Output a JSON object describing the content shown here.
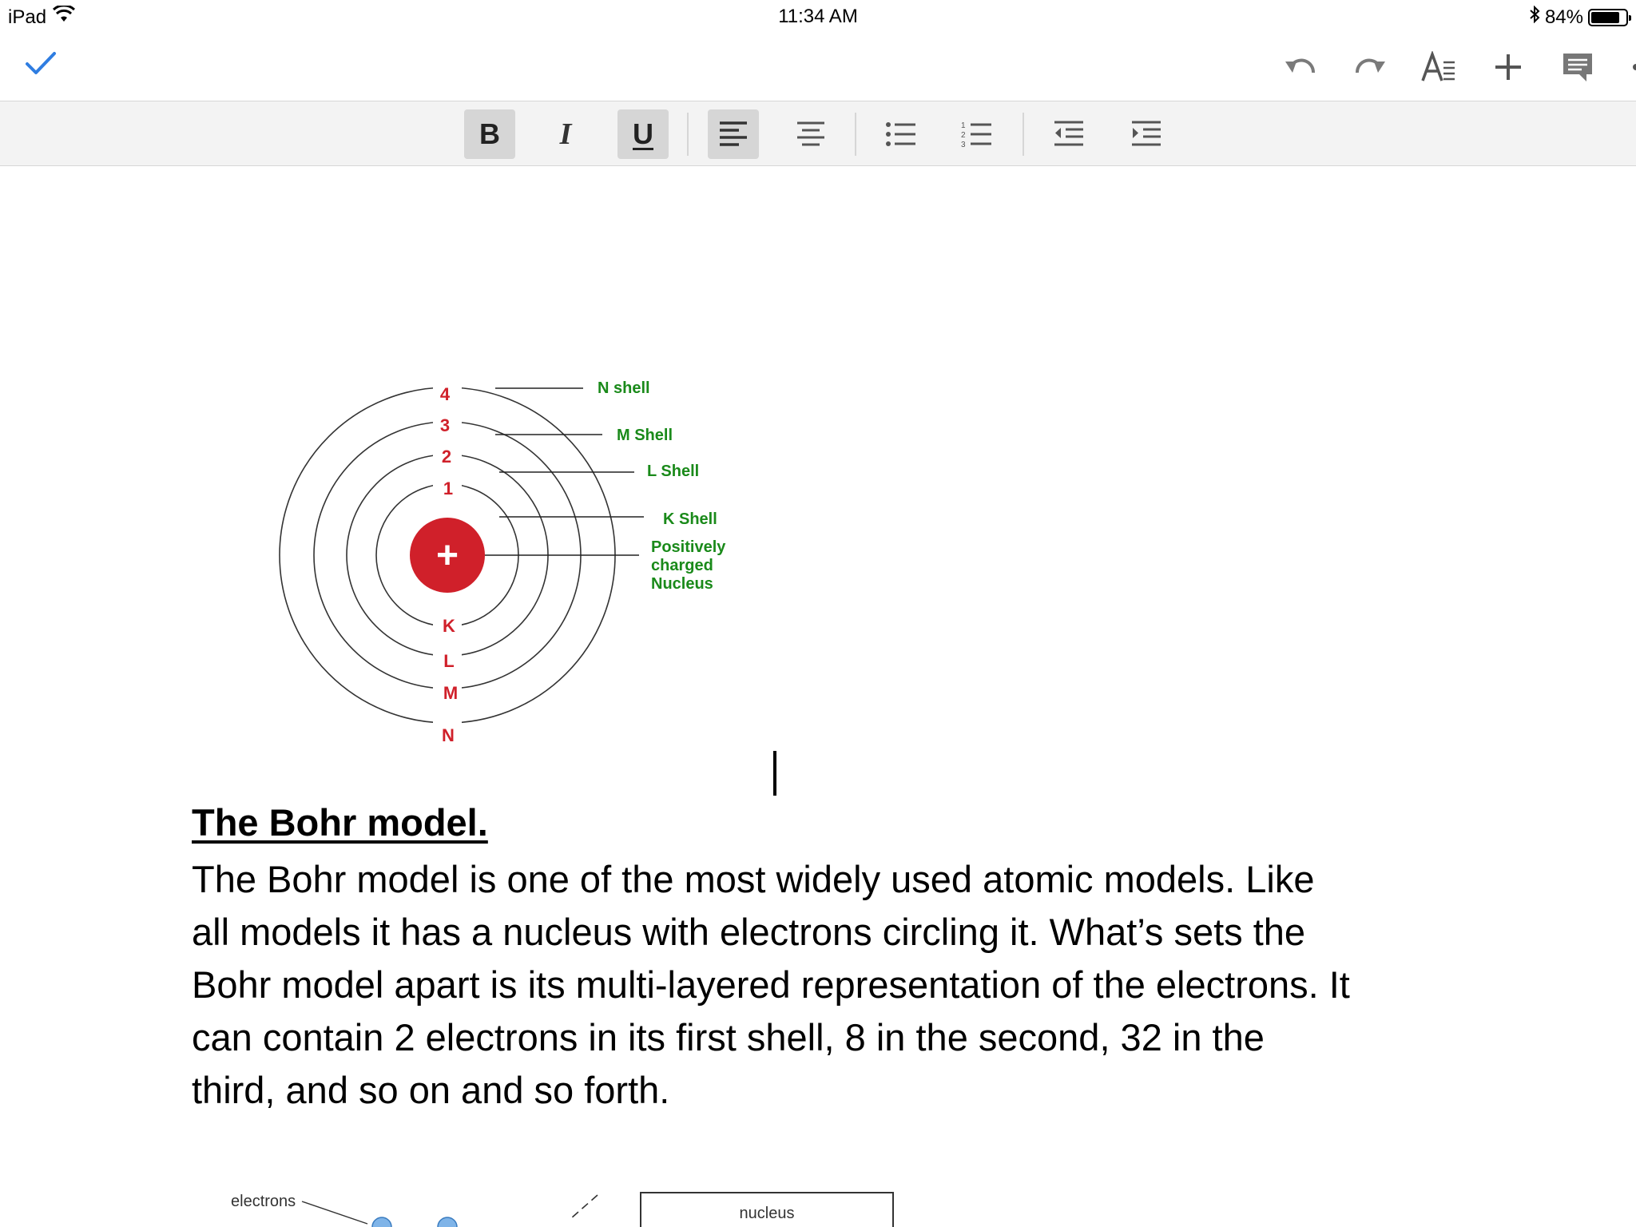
{
  "status": {
    "device": "iPad",
    "time": "11:34 AM",
    "battery_text": "84%",
    "battery_level": 0.84
  },
  "toolbar": {
    "done_icon": "checkmark-icon",
    "actions": [
      "undo-icon",
      "redo-icon",
      "text-format-icon",
      "insert-plus-icon",
      "comment-icon",
      "more-icon"
    ]
  },
  "format": {
    "bold_label": "B",
    "italic_label": "I",
    "underline_label": "U",
    "bold_active": true,
    "underline_active": true,
    "align_left_active": true,
    "icons": [
      "align-left-icon",
      "align-center-icon",
      "bulleted-list-icon",
      "numbered-list-icon",
      "decrease-indent-icon",
      "increase-indent-icon"
    ]
  },
  "diagram": {
    "numbers": [
      "4",
      "3",
      "2",
      "1"
    ],
    "letters": [
      "K",
      "L",
      "M",
      "N"
    ],
    "labels": {
      "n_shell": "N shell",
      "m_shell": "M Shell",
      "l_shell": "L Shell",
      "k_shell": "K Shell",
      "nucleus_1": "Positively",
      "nucleus_2": "charged",
      "nucleus_3": "Nucleus"
    },
    "nucleus_symbol": "+",
    "colors": {
      "nucleus": "#d0202a",
      "labels": "#1a8a1a",
      "numbers": "#d0202a"
    }
  },
  "document": {
    "heading": "The Bohr model.",
    "paragraph_lines": [
      "The Bohr model is one of the most widely used atomic models. Like",
      "all models it has a nucleus with electrons circling it. What’s sets the",
      "Bohr model apart is its multi-layered representation of the electrons. It",
      "can contain 2 electrons in its first shell, 8 in the second, 32 in the",
      "third, and so on and so forth."
    ]
  },
  "diagram2": {
    "electrons_label": "electrons",
    "nucleus_label": "nucleus"
  }
}
